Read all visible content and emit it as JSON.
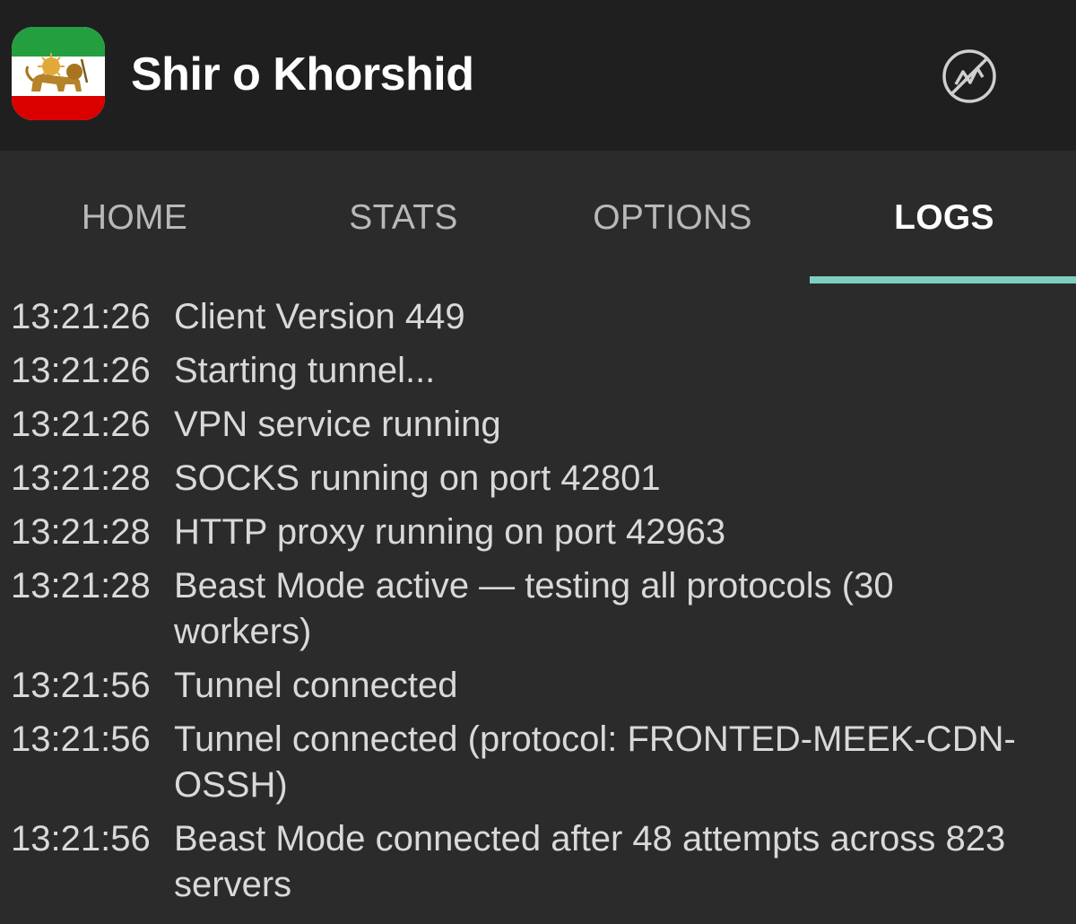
{
  "appbar": {
    "title": "Shir o Khorshid",
    "icon": "lion-and-sun-flag-icon",
    "action_icon": "speed-off-icon"
  },
  "tabs": [
    {
      "label": "HOME",
      "active": false
    },
    {
      "label": "STATS",
      "active": false
    },
    {
      "label": "OPTIONS",
      "active": false
    },
    {
      "label": "LOGS",
      "active": true
    }
  ],
  "logs": [
    {
      "time": "13:21:26",
      "message": "Client Version 449"
    },
    {
      "time": "13:21:26",
      "message": "Starting tunnel..."
    },
    {
      "time": "13:21:26",
      "message": "VPN service running"
    },
    {
      "time": "13:21:28",
      "message": "SOCKS running on port 42801"
    },
    {
      "time": "13:21:28",
      "message": "HTTP proxy running on port 42963"
    },
    {
      "time": "13:21:28",
      "message": "Beast Mode active — testing all protocols (30 workers)"
    },
    {
      "time": "13:21:56",
      "message": "Tunnel connected"
    },
    {
      "time": "13:21:56",
      "message": "Tunnel connected (protocol: FRONTED-MEEK-CDN-OSSH)"
    },
    {
      "time": "13:21:56",
      "message": "Beast Mode connected after 48 attempts across 823 servers"
    }
  ],
  "colors": {
    "appbar_bg": "#1f1f1f",
    "content_bg": "#2b2b2b",
    "tab_indicator": "#7fcfc1",
    "flag_green": "#239f40",
    "flag_white": "#ffffff",
    "flag_red": "#da0000",
    "emblem_gold": "#c8962e"
  }
}
